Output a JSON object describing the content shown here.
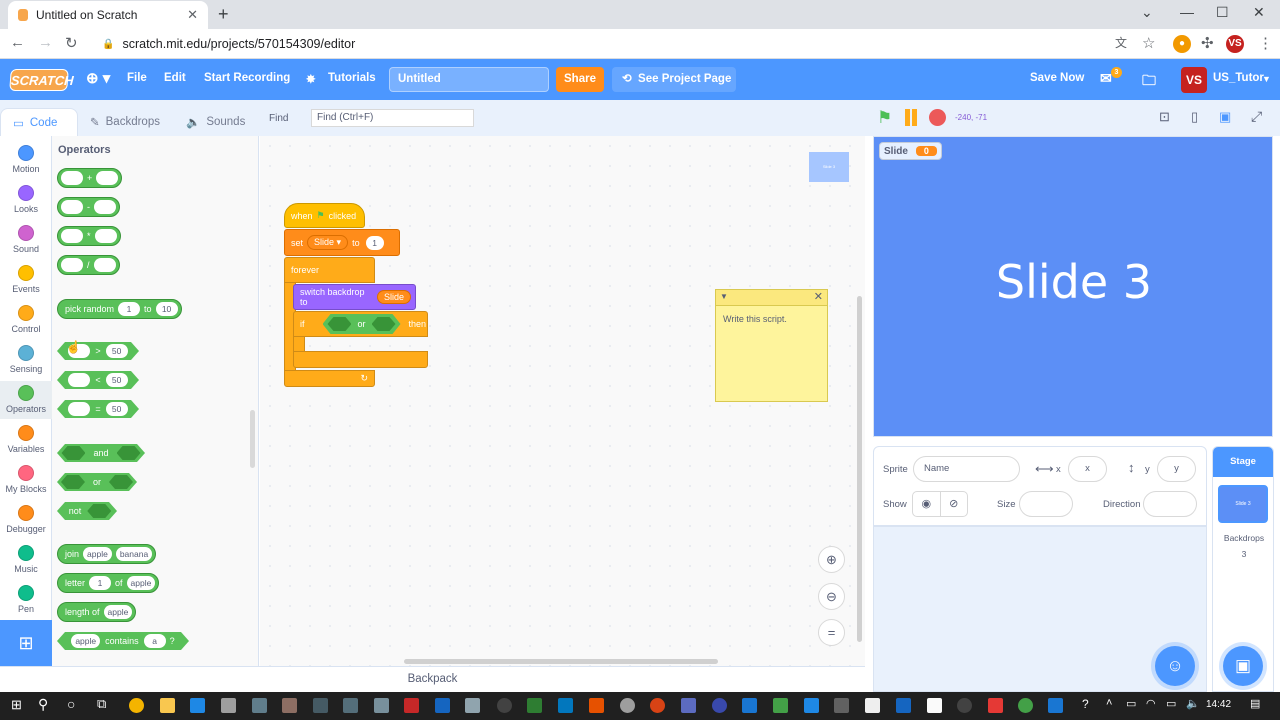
{
  "browser": {
    "tab_title": "Untitled on Scratch",
    "url": "scratch.mit.edu/projects/570154309/editor"
  },
  "menubar": {
    "logo": "SCRATCH",
    "file": "File",
    "edit": "Edit",
    "start_recording": "Start Recording",
    "tutorials": "Tutorials",
    "project_title": "Untitled",
    "share": "Share",
    "see_project_page": "See Project Page",
    "save_now": "Save Now",
    "username": "US_Tutor",
    "avatar": "VS",
    "messages_count": "3"
  },
  "tabs": {
    "code": "Code",
    "backdrops": "Backdrops",
    "sounds": "Sounds"
  },
  "find": {
    "label": "Find",
    "placeholder": "Find (Ctrl+F)"
  },
  "categories": [
    {
      "label": "Motion",
      "color": "#4c97ff"
    },
    {
      "label": "Looks",
      "color": "#9966ff"
    },
    {
      "label": "Sound",
      "color": "#cf63cf"
    },
    {
      "label": "Events",
      "color": "#ffbf00"
    },
    {
      "label": "Control",
      "color": "#ffab19"
    },
    {
      "label": "Sensing",
      "color": "#5cb1d6"
    },
    {
      "label": "Operators",
      "color": "#59c059"
    },
    {
      "label": "Variables",
      "color": "#ff8c1a"
    },
    {
      "label": "My Blocks",
      "color": "#ff6680"
    },
    {
      "label": "Debugger",
      "color": "#ff8c1a"
    },
    {
      "label": "Music",
      "color": "#0fbd8c"
    },
    {
      "label": "Pen",
      "color": "#0fbd8c"
    }
  ],
  "palette": {
    "title": "Operators",
    "add": "+",
    "sub": "-",
    "mul": "*",
    "div": "/",
    "pick_random": "pick random",
    "to": "to",
    "rand_from": "1",
    "rand_to": "10",
    "gt": ">",
    "lt": "<",
    "eq": "=",
    "cmp_val": "50",
    "and": "and",
    "or": "or",
    "not": "not",
    "join": "join",
    "apple": "apple",
    "banana": "banana",
    "letter": "letter",
    "of": "of",
    "letter_idx": "1",
    "length_of": "length of",
    "contains": "contains",
    "a": "a",
    "q": "?"
  },
  "script": {
    "when": "when",
    "clicked": "clicked",
    "set": "set",
    "var": "Slide",
    "to": "to",
    "set_val": "1",
    "forever": "forever",
    "switch_backdrop": "switch backdrop to",
    "backdrop_var": "Slide",
    "if": "if",
    "or": "or",
    "then": "then"
  },
  "note": {
    "text": "Write this script."
  },
  "minimap_label": "Slide 3",
  "stage": {
    "coords": "-240, -71",
    "monitor_label": "Slide",
    "monitor_value": "0",
    "text": "Slide 3"
  },
  "sprite_info": {
    "sprite_label": "Sprite",
    "name_placeholder": "Name",
    "x_label": "x",
    "x_placeholder": "x",
    "y_label": "y",
    "y_placeholder": "y",
    "show_label": "Show",
    "size_label": "Size",
    "direction_label": "Direction"
  },
  "stage_pane": {
    "title": "Stage",
    "thumb_label": "Slide 3",
    "backdrops_label": "Backdrops",
    "backdrops_count": "3"
  },
  "backpack": "Backpack",
  "taskbar": {
    "time": "14:42"
  }
}
